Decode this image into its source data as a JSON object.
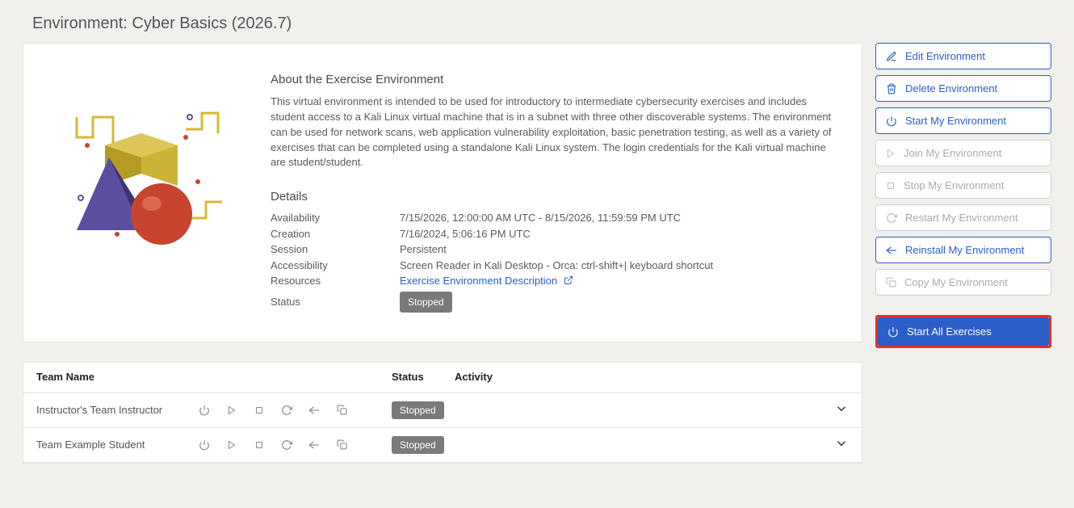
{
  "page_title": "Environment: Cyber Basics (2026.7)",
  "about": {
    "heading": "About the Exercise Environment",
    "text": "This virtual environment is intended to be used for introductory to intermediate cybersecurity exercises and includes student access to a Kali Linux virtual machine that is in a subnet with three other discoverable systems. The environment can be used for network scans, web application vulnerability exploitation, basic penetration testing, as well as a variety of exercises that can be completed using a standalone Kali Linux system. The login credentials for the Kali virtual machine are student/student."
  },
  "details": {
    "heading": "Details",
    "availability": {
      "label": "Availability",
      "value": "7/15/2026, 12:00:00 AM UTC - 8/15/2026, 11:59:59 PM UTC"
    },
    "creation": {
      "label": "Creation",
      "value": "7/16/2024, 5:06:16 PM UTC"
    },
    "session": {
      "label": "Session",
      "value": "Persistent"
    },
    "accessibility": {
      "label": "Accessibility",
      "value": "Screen Reader in Kali Desktop - Orca: ctrl-shift+| keyboard shortcut"
    },
    "resources": {
      "label": "Resources",
      "link": "Exercise Environment Description"
    },
    "status": {
      "label": "Status",
      "value": "Stopped"
    }
  },
  "actions": {
    "edit": {
      "label": "Edit Environment"
    },
    "delete": {
      "label": "Delete Environment"
    },
    "start": {
      "label": "Start My Environment"
    },
    "join": {
      "label": "Join My Environment"
    },
    "stop": {
      "label": "Stop My Environment"
    },
    "restart": {
      "label": "Restart My Environment"
    },
    "reinstall": {
      "label": "Reinstall My Environment"
    },
    "copy": {
      "label": "Copy My Environment"
    }
  },
  "team_table": {
    "headers": {
      "name": "Team Name",
      "status": "Status",
      "activity": "Activity"
    },
    "rows": [
      {
        "name": "Instructor's Team Instructor",
        "status": "Stopped"
      },
      {
        "name": "Team Example Student",
        "status": "Stopped"
      }
    ]
  },
  "start_all": {
    "label": "Start All Exercises"
  }
}
